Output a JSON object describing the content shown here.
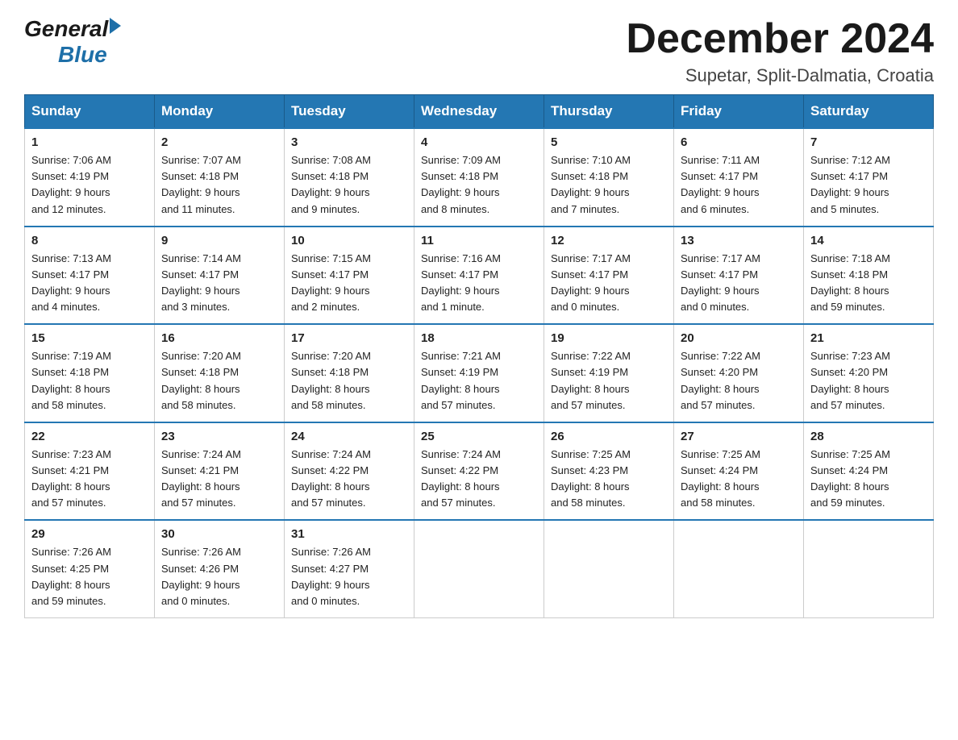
{
  "logo": {
    "general": "General",
    "blue": "Blue"
  },
  "header": {
    "month": "December 2024",
    "location": "Supetar, Split-Dalmatia, Croatia"
  },
  "days_of_week": [
    "Sunday",
    "Monday",
    "Tuesday",
    "Wednesday",
    "Thursday",
    "Friday",
    "Saturday"
  ],
  "weeks": [
    [
      {
        "day": "1",
        "sunrise": "7:06 AM",
        "sunset": "4:19 PM",
        "daylight": "9 hours and 12 minutes."
      },
      {
        "day": "2",
        "sunrise": "7:07 AM",
        "sunset": "4:18 PM",
        "daylight": "9 hours and 11 minutes."
      },
      {
        "day": "3",
        "sunrise": "7:08 AM",
        "sunset": "4:18 PM",
        "daylight": "9 hours and 9 minutes."
      },
      {
        "day": "4",
        "sunrise": "7:09 AM",
        "sunset": "4:18 PM",
        "daylight": "9 hours and 8 minutes."
      },
      {
        "day": "5",
        "sunrise": "7:10 AM",
        "sunset": "4:18 PM",
        "daylight": "9 hours and 7 minutes."
      },
      {
        "day": "6",
        "sunrise": "7:11 AM",
        "sunset": "4:17 PM",
        "daylight": "9 hours and 6 minutes."
      },
      {
        "day": "7",
        "sunrise": "7:12 AM",
        "sunset": "4:17 PM",
        "daylight": "9 hours and 5 minutes."
      }
    ],
    [
      {
        "day": "8",
        "sunrise": "7:13 AM",
        "sunset": "4:17 PM",
        "daylight": "9 hours and 4 minutes."
      },
      {
        "day": "9",
        "sunrise": "7:14 AM",
        "sunset": "4:17 PM",
        "daylight": "9 hours and 3 minutes."
      },
      {
        "day": "10",
        "sunrise": "7:15 AM",
        "sunset": "4:17 PM",
        "daylight": "9 hours and 2 minutes."
      },
      {
        "day": "11",
        "sunrise": "7:16 AM",
        "sunset": "4:17 PM",
        "daylight": "9 hours and 1 minute."
      },
      {
        "day": "12",
        "sunrise": "7:17 AM",
        "sunset": "4:17 PM",
        "daylight": "9 hours and 0 minutes."
      },
      {
        "day": "13",
        "sunrise": "7:17 AM",
        "sunset": "4:17 PM",
        "daylight": "9 hours and 0 minutes."
      },
      {
        "day": "14",
        "sunrise": "7:18 AM",
        "sunset": "4:18 PM",
        "daylight": "8 hours and 59 minutes."
      }
    ],
    [
      {
        "day": "15",
        "sunrise": "7:19 AM",
        "sunset": "4:18 PM",
        "daylight": "8 hours and 58 minutes."
      },
      {
        "day": "16",
        "sunrise": "7:20 AM",
        "sunset": "4:18 PM",
        "daylight": "8 hours and 58 minutes."
      },
      {
        "day": "17",
        "sunrise": "7:20 AM",
        "sunset": "4:18 PM",
        "daylight": "8 hours and 58 minutes."
      },
      {
        "day": "18",
        "sunrise": "7:21 AM",
        "sunset": "4:19 PM",
        "daylight": "8 hours and 57 minutes."
      },
      {
        "day": "19",
        "sunrise": "7:22 AM",
        "sunset": "4:19 PM",
        "daylight": "8 hours and 57 minutes."
      },
      {
        "day": "20",
        "sunrise": "7:22 AM",
        "sunset": "4:20 PM",
        "daylight": "8 hours and 57 minutes."
      },
      {
        "day": "21",
        "sunrise": "7:23 AM",
        "sunset": "4:20 PM",
        "daylight": "8 hours and 57 minutes."
      }
    ],
    [
      {
        "day": "22",
        "sunrise": "7:23 AM",
        "sunset": "4:21 PM",
        "daylight": "8 hours and 57 minutes."
      },
      {
        "day": "23",
        "sunrise": "7:24 AM",
        "sunset": "4:21 PM",
        "daylight": "8 hours and 57 minutes."
      },
      {
        "day": "24",
        "sunrise": "7:24 AM",
        "sunset": "4:22 PM",
        "daylight": "8 hours and 57 minutes."
      },
      {
        "day": "25",
        "sunrise": "7:24 AM",
        "sunset": "4:22 PM",
        "daylight": "8 hours and 57 minutes."
      },
      {
        "day": "26",
        "sunrise": "7:25 AM",
        "sunset": "4:23 PM",
        "daylight": "8 hours and 58 minutes."
      },
      {
        "day": "27",
        "sunrise": "7:25 AM",
        "sunset": "4:24 PM",
        "daylight": "8 hours and 58 minutes."
      },
      {
        "day": "28",
        "sunrise": "7:25 AM",
        "sunset": "4:24 PM",
        "daylight": "8 hours and 59 minutes."
      }
    ],
    [
      {
        "day": "29",
        "sunrise": "7:26 AM",
        "sunset": "4:25 PM",
        "daylight": "8 hours and 59 minutes."
      },
      {
        "day": "30",
        "sunrise": "7:26 AM",
        "sunset": "4:26 PM",
        "daylight": "9 hours and 0 minutes."
      },
      {
        "day": "31",
        "sunrise": "7:26 AM",
        "sunset": "4:27 PM",
        "daylight": "9 hours and 0 minutes."
      },
      null,
      null,
      null,
      null
    ]
  ],
  "labels": {
    "sunrise": "Sunrise:",
    "sunset": "Sunset:",
    "daylight": "Daylight:"
  },
  "colors": {
    "header_bg": "#2477b3",
    "header_text": "#ffffff",
    "border_top": "#2477b3"
  }
}
